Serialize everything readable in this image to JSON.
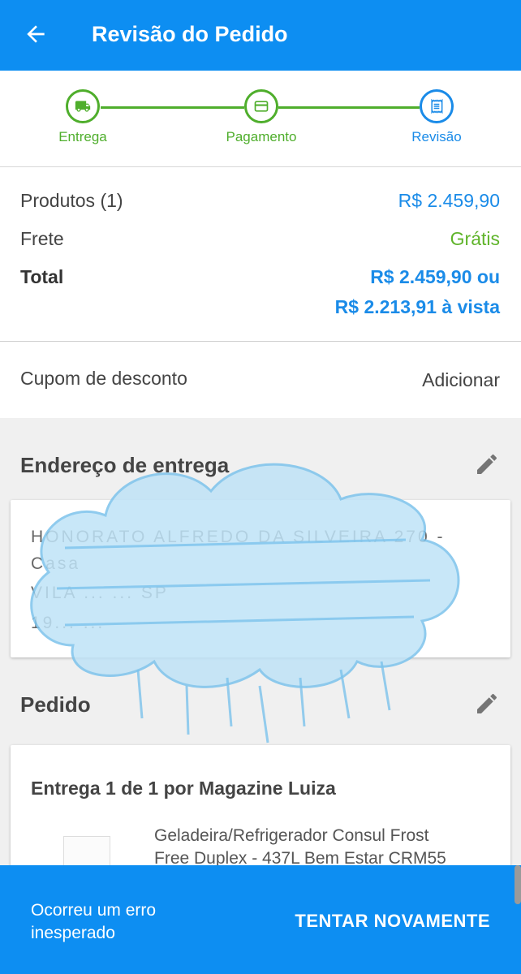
{
  "appbar": {
    "title": "Revisão do Pedido",
    "back_icon": "arrow-back-icon",
    "color": "#0d8ef2"
  },
  "stepper": {
    "steps": [
      {
        "label": "Entrega",
        "icon": "truck-icon",
        "color": "#4fae2c"
      },
      {
        "label": "Pagamento",
        "icon": "card-icon",
        "color": "#4fae2c"
      },
      {
        "label": "Revisão",
        "icon": "receipt-icon",
        "color": "#1a8be8"
      }
    ]
  },
  "summary": {
    "products_label": "Produtos (1)",
    "products_value": "R$ 2.459,90",
    "shipping_label": "Frete",
    "shipping_value": "Grátis",
    "total_label": "Total",
    "total_value_line1": "R$ 2.459,90 ou",
    "total_value_line2": "R$ 2.213,91 à vista"
  },
  "coupon": {
    "label": "Cupom de desconto",
    "action": "Adicionar"
  },
  "address": {
    "title": "Endereço de entrega",
    "edit_icon": "pencil-icon",
    "lines": [
      "HONORATO ALFREDO DA SILVEIRA 270 -",
      "Casa",
      "VILA ... ... SP",
      "19... ..."
    ]
  },
  "order": {
    "title": "Pedido",
    "edit_icon": "pencil-icon",
    "delivery_heading": "Entrega 1 de 1 por Magazine Luiza",
    "product_name_line1": "Geladeira/Refrigerador Consul Frost",
    "product_name_line2": "Free Duplex - 437L Bem Estar CRM55"
  },
  "snackbar": {
    "message_line1": "Ocorreu um erro",
    "message_line2": "inesperado",
    "action": "TENTAR NOVAMENTE"
  }
}
